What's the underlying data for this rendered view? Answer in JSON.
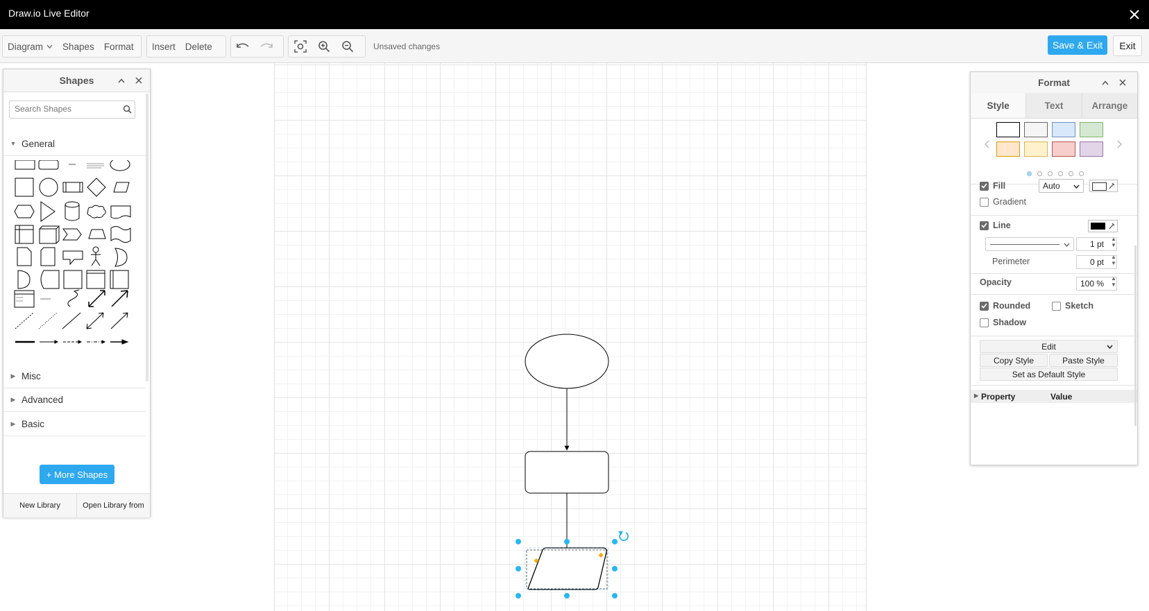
{
  "window": {
    "title": "Draw.io Live Editor"
  },
  "toolbar": {
    "diagram_menu": "Diagram",
    "shapes": "Shapes",
    "format": "Format",
    "insert": "Insert",
    "delete": "Delete",
    "status": "Unsaved changes",
    "save_exit": "Save & Exit",
    "exit": "Exit"
  },
  "shapes_panel": {
    "title": "Shapes",
    "search_placeholder": "Search Shapes",
    "sections": {
      "general": "General",
      "misc": "Misc",
      "advanced": "Advanced",
      "basic": "Basic"
    },
    "more_shapes": "+ More Shapes",
    "new_library": "New Library",
    "open_library": "Open Library from"
  },
  "format_panel": {
    "title": "Format",
    "tabs": [
      "Style",
      "Text",
      "Arrange"
    ],
    "swatches": [
      "#ffffff",
      "#f5f5f5",
      "#dae8fc",
      "#d5e8d4",
      "#ffe6cc",
      "#fff2cc",
      "#f8cecc",
      "#e1d5e7"
    ],
    "swatch_borders": [
      "#000000",
      "#666666",
      "#6c8ebf",
      "#82b366",
      "#d79b00",
      "#d6b656",
      "#b85450",
      "#9673a6"
    ],
    "fill": {
      "label": "Fill",
      "checked": true,
      "mode": "Auto"
    },
    "gradient": {
      "label": "Gradient",
      "checked": false
    },
    "line": {
      "label": "Line",
      "checked": true,
      "width": "1 pt"
    },
    "perimeter": {
      "label": "Perimeter",
      "value": "0 pt"
    },
    "opacity": {
      "label": "Opacity",
      "value": "100 %"
    },
    "rounded": {
      "label": "Rounded",
      "checked": true
    },
    "sketch": {
      "label": "Sketch",
      "checked": false
    },
    "shadow": {
      "label": "Shadow",
      "checked": false
    },
    "edit": "Edit",
    "copy_style": "Copy Style",
    "paste_style": "Paste Style",
    "set_default": "Set as Default Style",
    "property": "Property",
    "value": "Value"
  },
  "colors": {
    "accent": "#2ea8ef",
    "handle": "#29b6f2",
    "corner_handle": "#ffa500"
  }
}
